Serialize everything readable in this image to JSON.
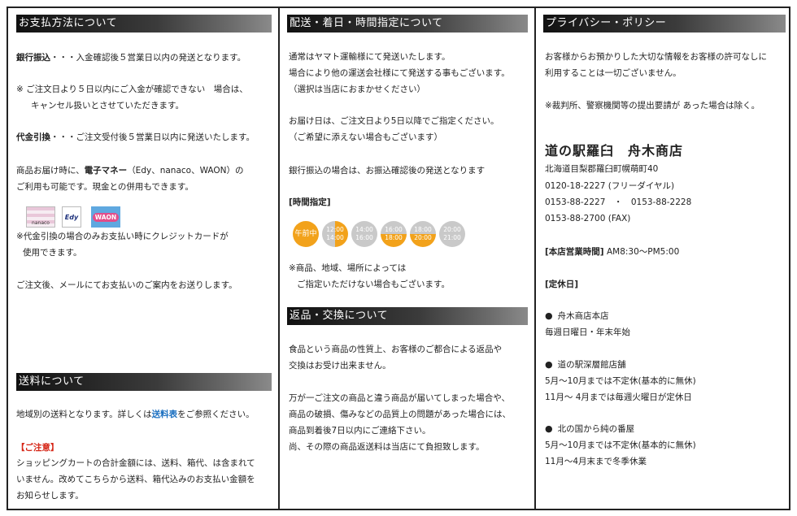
{
  "payment": {
    "title": "お支払方法について",
    "bank_label": "銀行振込",
    "bank_text": "・・・入金確認後５営業日以内の発送となります。",
    "note_line1": "※ ご注文日より５日以内にご入金が確認できない　場合は、",
    "note_line2": "キャンセル扱いとさせていただきます。",
    "cod_label": "代金引換",
    "cod_text": "・・・ご注文受付後５営業日以内に発送いたします。",
    "emoney_pre": "商品お届け時に、",
    "emoney_label": "電子マネー",
    "emoney_post": "（Edy、nanaco、WAON）の",
    "emoney_line2": "ご利用も可能です。現金との併用もできます。",
    "icons": [
      "nanaco-icon",
      "edy-icon",
      "waon-icon"
    ],
    "icon_texts": [
      "nanaco",
      "Edy",
      "WAON"
    ],
    "card_line1": "※代金引換の場合のみお支払い時にクレジットカードが",
    "card_line2": "使用できます。",
    "mail_text": "ご注文後、メールにてお支払いのご案内をお送りします。"
  },
  "shipping_fee": {
    "title": "送料について",
    "line1_pre": "地域別の送料となります。詳しくは",
    "line1_link": "送料表",
    "line1_post": "をご参照ください。",
    "notice_title": "【ご注意】",
    "notice_lines": [
      "ショッピングカートの合計金額には、送料、箱代、は含まれて",
      "いません。改めてこちらから送料、箱代込みのお支払い金額を",
      "お知らせします。"
    ]
  },
  "delivery": {
    "title": "配送・着日・時間指定について",
    "lines_a": [
      "通常はヤマト運輸様にて発送いたします。",
      "場合により他の運送会社様にて発送する事もございます。",
      "（選択は当店におまかせください）"
    ],
    "lines_b": [
      "お届け日は、ご注文日より5日以降でご指定ください。",
      "（ご希望に添えない場合もございます）"
    ],
    "bank_note": "銀行振込の場合は、お振込確認後の発送となります",
    "time_title": "[時間指定]",
    "slots": [
      {
        "top": "午前中",
        "bottom": ""
      },
      {
        "top": "12:00",
        "bottom": "14:00"
      },
      {
        "top": "14:00",
        "bottom": "16:00"
      },
      {
        "top": "16:00",
        "bottom": "18:00"
      },
      {
        "top": "18:00",
        "bottom": "20:00"
      },
      {
        "top": "20:00",
        "bottom": "21:00"
      }
    ],
    "note_lines": [
      "※商品、地域、場所によっては",
      "ご指定いただけない場合もございます。"
    ]
  },
  "returns": {
    "title": "返品・交換について",
    "lines_a": [
      "食品という商品の性質上、お客様のご都合による返品や",
      "交換はお受け出来ません。"
    ],
    "lines_b": [
      "万が一ご注文の商品と違う商品が届いてしまった場合や、",
      "商品の破損、傷みなどの品質上の問題があった場合には、",
      "商品到着後7日以内にご連絡下さい。",
      "尚、その際の商品返送料は当店にて負担致します。"
    ]
  },
  "privacy": {
    "title": "プライバシー・ポリシー",
    "lines": [
      "お客様からお預かりした大切な情報をお客様の許可なしに",
      "利用することは一切ございません。"
    ],
    "note": "※裁判所、警察機関等の提出要請が あった場合は除く。"
  },
  "shop": {
    "name": "道の駅羅臼　舟木商店",
    "address": "北海道目梨郡羅臼町幌萌町40",
    "tel_free": "0120-18-2227 (フリーダイヤル)",
    "tel": "0153-88-2227　・　0153-88-2228",
    "fax": "0153-88-2700 (FAX)",
    "hours_label": "[本店営業時間]",
    "hours_value": "AM8:30～PM5:00",
    "holiday_title": "[定休日]",
    "stores": [
      {
        "name": "舟木商店本店",
        "lines": [
          "毎週日曜日・年末年始"
        ]
      },
      {
        "name": "道の駅深層館店舗",
        "lines": [
          "5月～10月までは不定休(基本的に無休)",
          "11月～ 4月までは毎週火曜日が定休日"
        ]
      },
      {
        "name": "北の国から純の番屋",
        "lines": [
          "5月～10月までは不定休(基本的に無休)",
          "11月～4月末まで冬季休業"
        ]
      }
    ]
  }
}
